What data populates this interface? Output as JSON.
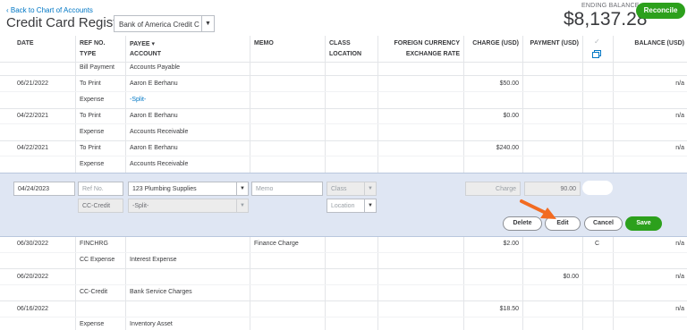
{
  "header": {
    "back_link": "‹ Back to Chart of Accounts",
    "title": "Credit Card Register",
    "account_selected": "Bank of America Credit Car",
    "ending_balance_label": "ENDING BALANCE",
    "ending_balance": "$8,137.28",
    "reconcile_label": "Reconcile"
  },
  "columns": {
    "date": "DATE",
    "ref_no": "REF NO.",
    "type": "TYPE",
    "payee": "PAYEE ▾",
    "account": "ACCOUNT",
    "memo": "MEMO",
    "class": "CLASS",
    "location": "LOCATION",
    "foreign_currency": "FOREIGN CURRENCY",
    "exchange_rate": "EXCHANGE RATE",
    "charge": "CHARGE (USD)",
    "payment": "PAYMENT (USD)",
    "balance": "BALANCE (USD)"
  },
  "rows_top": [
    {
      "type": "Bill Payment",
      "account": "Accounts Payable"
    },
    {
      "date": "06/21/2022",
      "ref": "To Print",
      "payee": "Aaron E Berhanu",
      "charge": "$50.00",
      "balance": "n/a",
      "type": "Expense",
      "account": "-Split-"
    },
    {
      "date": "04/22/2021",
      "ref": "To Print",
      "payee": "Aaron E Berhanu",
      "charge": "$0.00",
      "balance": "n/a",
      "type": "Expense",
      "account": "Accounts Receivable"
    },
    {
      "date": "04/22/2021",
      "ref": "To Print",
      "payee": "Aaron E Berhanu",
      "charge": "$240.00",
      "balance": "n/a",
      "type": "Expense",
      "account": "Accounts Receivable"
    }
  ],
  "edit_row": {
    "date": "04/24/2023",
    "ref_placeholder": "Ref No.",
    "payee": "123 Plumbing Supplies",
    "memo_placeholder": "Memo",
    "class_placeholder": "Class",
    "charge_placeholder": "Charge",
    "payment": "90.00",
    "type": "CC-Credit",
    "account": "-Split-",
    "location_placeholder": "Location",
    "delete_label": "Delete",
    "edit_label": "Edit",
    "cancel_label": "Cancel",
    "save_label": "Save"
  },
  "rows_bottom": [
    {
      "date": "06/30/2022",
      "ref": "FINCHRG",
      "memo": "Finance Charge",
      "charge": "$2.00",
      "cleared": "C",
      "balance": "n/a",
      "type": "CC Expense",
      "account": "Interest Expense"
    },
    {
      "date": "06/20/2022",
      "payment": "$0.00",
      "balance": "n/a",
      "type": "CC-Credit",
      "account": "Bank Service Charges"
    },
    {
      "date": "06/16/2022",
      "charge": "$18.50",
      "balance": "n/a",
      "type": "Expense",
      "account": "Inventory Asset"
    }
  ],
  "colors": {
    "accent": "#2ca01c",
    "link": "#0077c5",
    "edit_band": "#dfe6f3",
    "arrow": "#f26b21"
  }
}
